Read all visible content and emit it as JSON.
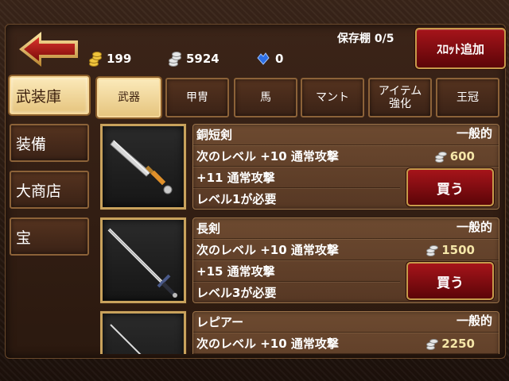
{
  "header": {
    "back_icon": "back-arrow-icon",
    "currencies": [
      {
        "icon": "gold-coins-icon",
        "value": "199"
      },
      {
        "icon": "silver-coins-icon",
        "value": "5924"
      },
      {
        "icon": "blue-gem-icon",
        "value": "0"
      }
    ],
    "storage_label": "保存棚 0/5",
    "add_slot_label": "ｽﾛｯﾄ追加"
  },
  "sidebar": {
    "items": [
      {
        "label": "武装庫",
        "active": true
      },
      {
        "label": "装備",
        "active": false
      },
      {
        "label": "大商店",
        "active": false
      },
      {
        "label": "宝",
        "active": false
      }
    ]
  },
  "tabs": [
    {
      "label": "武器",
      "active": true
    },
    {
      "label": "甲冑",
      "active": false
    },
    {
      "label": "馬",
      "active": false
    },
    {
      "label": "マント",
      "active": false
    },
    {
      "label": "アイテム\n強化",
      "active": false
    },
    {
      "label": "王冠",
      "active": false
    }
  ],
  "items": [
    {
      "name": "銅短剣",
      "rarity": "一般的",
      "next_level": "次のレベル +10 通常攻撃",
      "price": "600",
      "attack": "+11 通常攻撃",
      "requirement": "レベル1が必要",
      "buy_label": "買う",
      "icon": "bronze-dagger-icon"
    },
    {
      "name": "長剣",
      "rarity": "一般的",
      "next_level": "次のレベル +10 通常攻撃",
      "price": "1500",
      "attack": "+15 通常攻撃",
      "requirement": "レベル3が必要",
      "buy_label": "買う",
      "icon": "long-sword-icon"
    },
    {
      "name": "レピアー",
      "rarity": "一般的",
      "next_level": "次のレベル +10 通常攻撃",
      "price": "2250",
      "attack": "",
      "requirement": "",
      "buy_label": "",
      "icon": "rapier-icon"
    }
  ],
  "colors": {
    "button_red": "#a6141a",
    "gold_border": "#c9a25c",
    "active_tab": "#f6d89a"
  }
}
